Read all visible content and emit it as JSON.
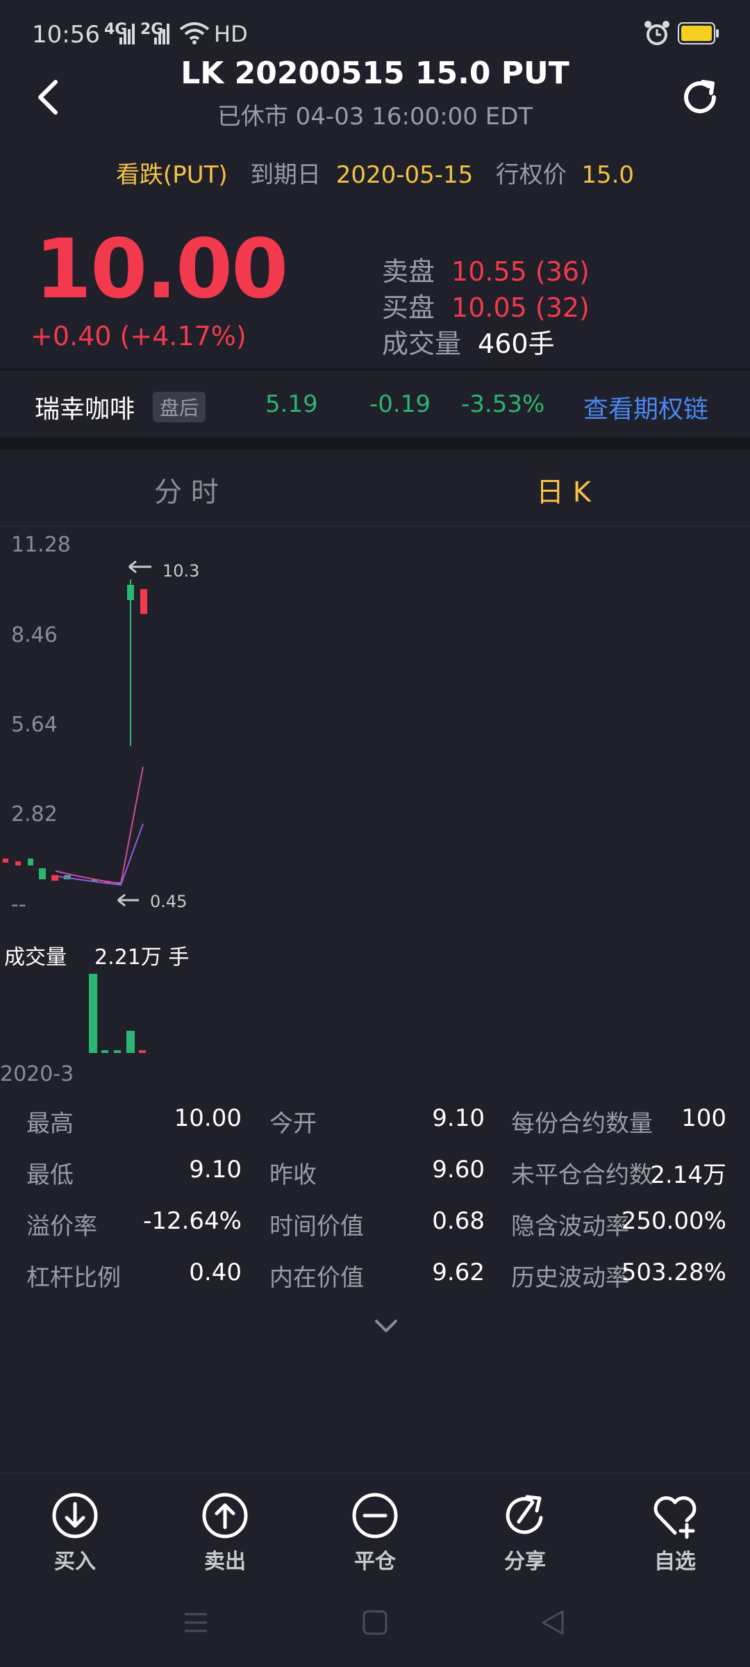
{
  "status": {
    "time": "10:56",
    "sig1": "4G",
    "sig2": "2G",
    "hd": "HD",
    "battery_color": "#f5d020"
  },
  "header": {
    "title": "LK 20200515 15.0 PUT",
    "subtitle": "已休市 04-03 16:00:00 EDT",
    "icons": {
      "back": "chevron-left-icon",
      "refresh": "refresh-icon"
    }
  },
  "option_info": {
    "type": "看跌(PUT)",
    "expiry_label": "到期日",
    "expiry": "2020-05-15",
    "strike_label": "行权价",
    "strike": "15.0"
  },
  "quote": {
    "price": "10.00",
    "change": "+0.40 (+4.17%)",
    "ask_label": "卖盘",
    "ask": "10.55 (36)",
    "bid_label": "买盘",
    "bid": "10.05 (32)",
    "volume_label": "成交量",
    "volume": "460手"
  },
  "underlying": {
    "name": "瑞幸咖啡",
    "badge": "盘后",
    "price": "5.19",
    "change": "-0.19",
    "change_pct": "-3.53%",
    "link": "查看期权链"
  },
  "tabs": [
    {
      "label": "分 时"
    },
    {
      "label": "日 K"
    }
  ],
  "chart": {
    "y_ticks": [
      "11.28",
      "8.46",
      "5.64",
      "2.82",
      "--"
    ],
    "high_marker": "10.3",
    "low_marker": "0.45",
    "volume_label": "成交量",
    "volume_value": "2.21万 手",
    "x_label": "2020-3",
    "up_color": "#f2394d",
    "down_color": "#2bb673"
  },
  "stats": [
    {
      "k": "最高",
      "v": "10.00"
    },
    {
      "k": "今开",
      "v": "9.10"
    },
    {
      "k": "每份合约数量",
      "v": "100"
    },
    {
      "k": "最低",
      "v": "9.10"
    },
    {
      "k": "昨收",
      "v": "9.60"
    },
    {
      "k": "未平仓合约数",
      "v": "2.14万"
    },
    {
      "k": "溢价率",
      "v": "-12.64%"
    },
    {
      "k": "时间价值",
      "v": "0.68"
    },
    {
      "k": "隐含波动率",
      "v": "250.00%"
    },
    {
      "k": "杠杆比例",
      "v": "0.40"
    },
    {
      "k": "内在价值",
      "v": "9.62"
    },
    {
      "k": "历史波动率",
      "v": "503.28%"
    }
  ],
  "actions": [
    {
      "label": "买入",
      "icon": "buy-icon"
    },
    {
      "label": "卖出",
      "icon": "sell-icon"
    },
    {
      "label": "平仓",
      "icon": "close-position-icon"
    },
    {
      "label": "分享",
      "icon": "share-icon"
    },
    {
      "label": "自选",
      "icon": "watchlist-add-icon"
    }
  ]
}
